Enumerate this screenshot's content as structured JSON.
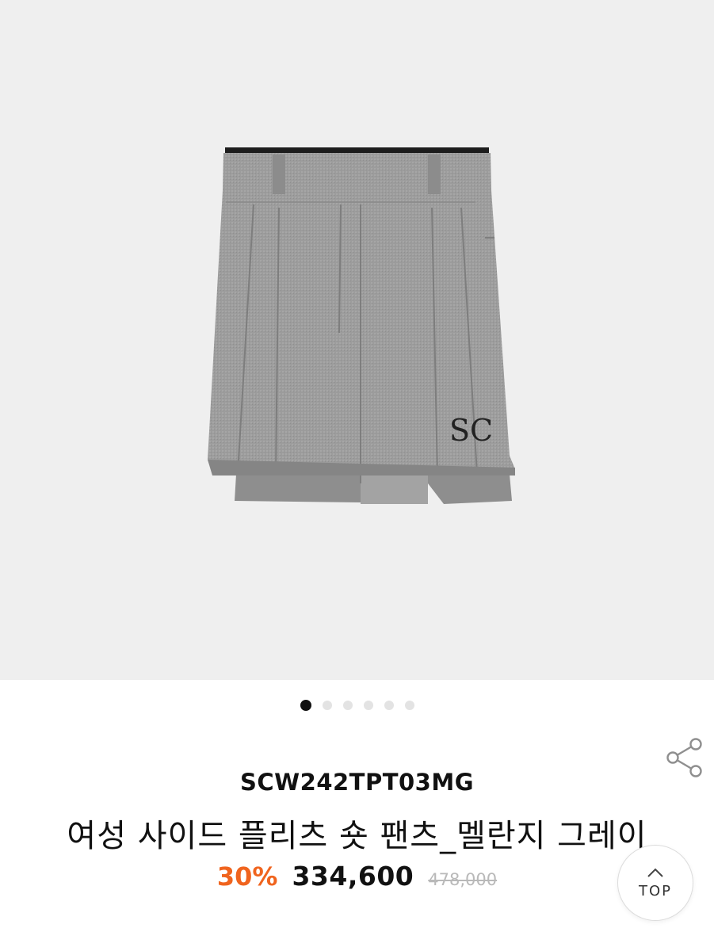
{
  "product": {
    "image_logo_text": "SC",
    "sku": "SCW242TPT03MG",
    "name": "여성 사이드 플리츠 숏 팬츠_멜란지 그레이",
    "discount": "30%",
    "price": "334,600",
    "original_price": "478,000"
  },
  "carousel": {
    "total_slides": 6,
    "active_index": 0
  },
  "actions": {
    "share_icon": "share-icon",
    "top_label": "TOP"
  },
  "colors": {
    "discount": "#f0641e",
    "garment": "#9b9b9b",
    "background": "#efefef"
  }
}
